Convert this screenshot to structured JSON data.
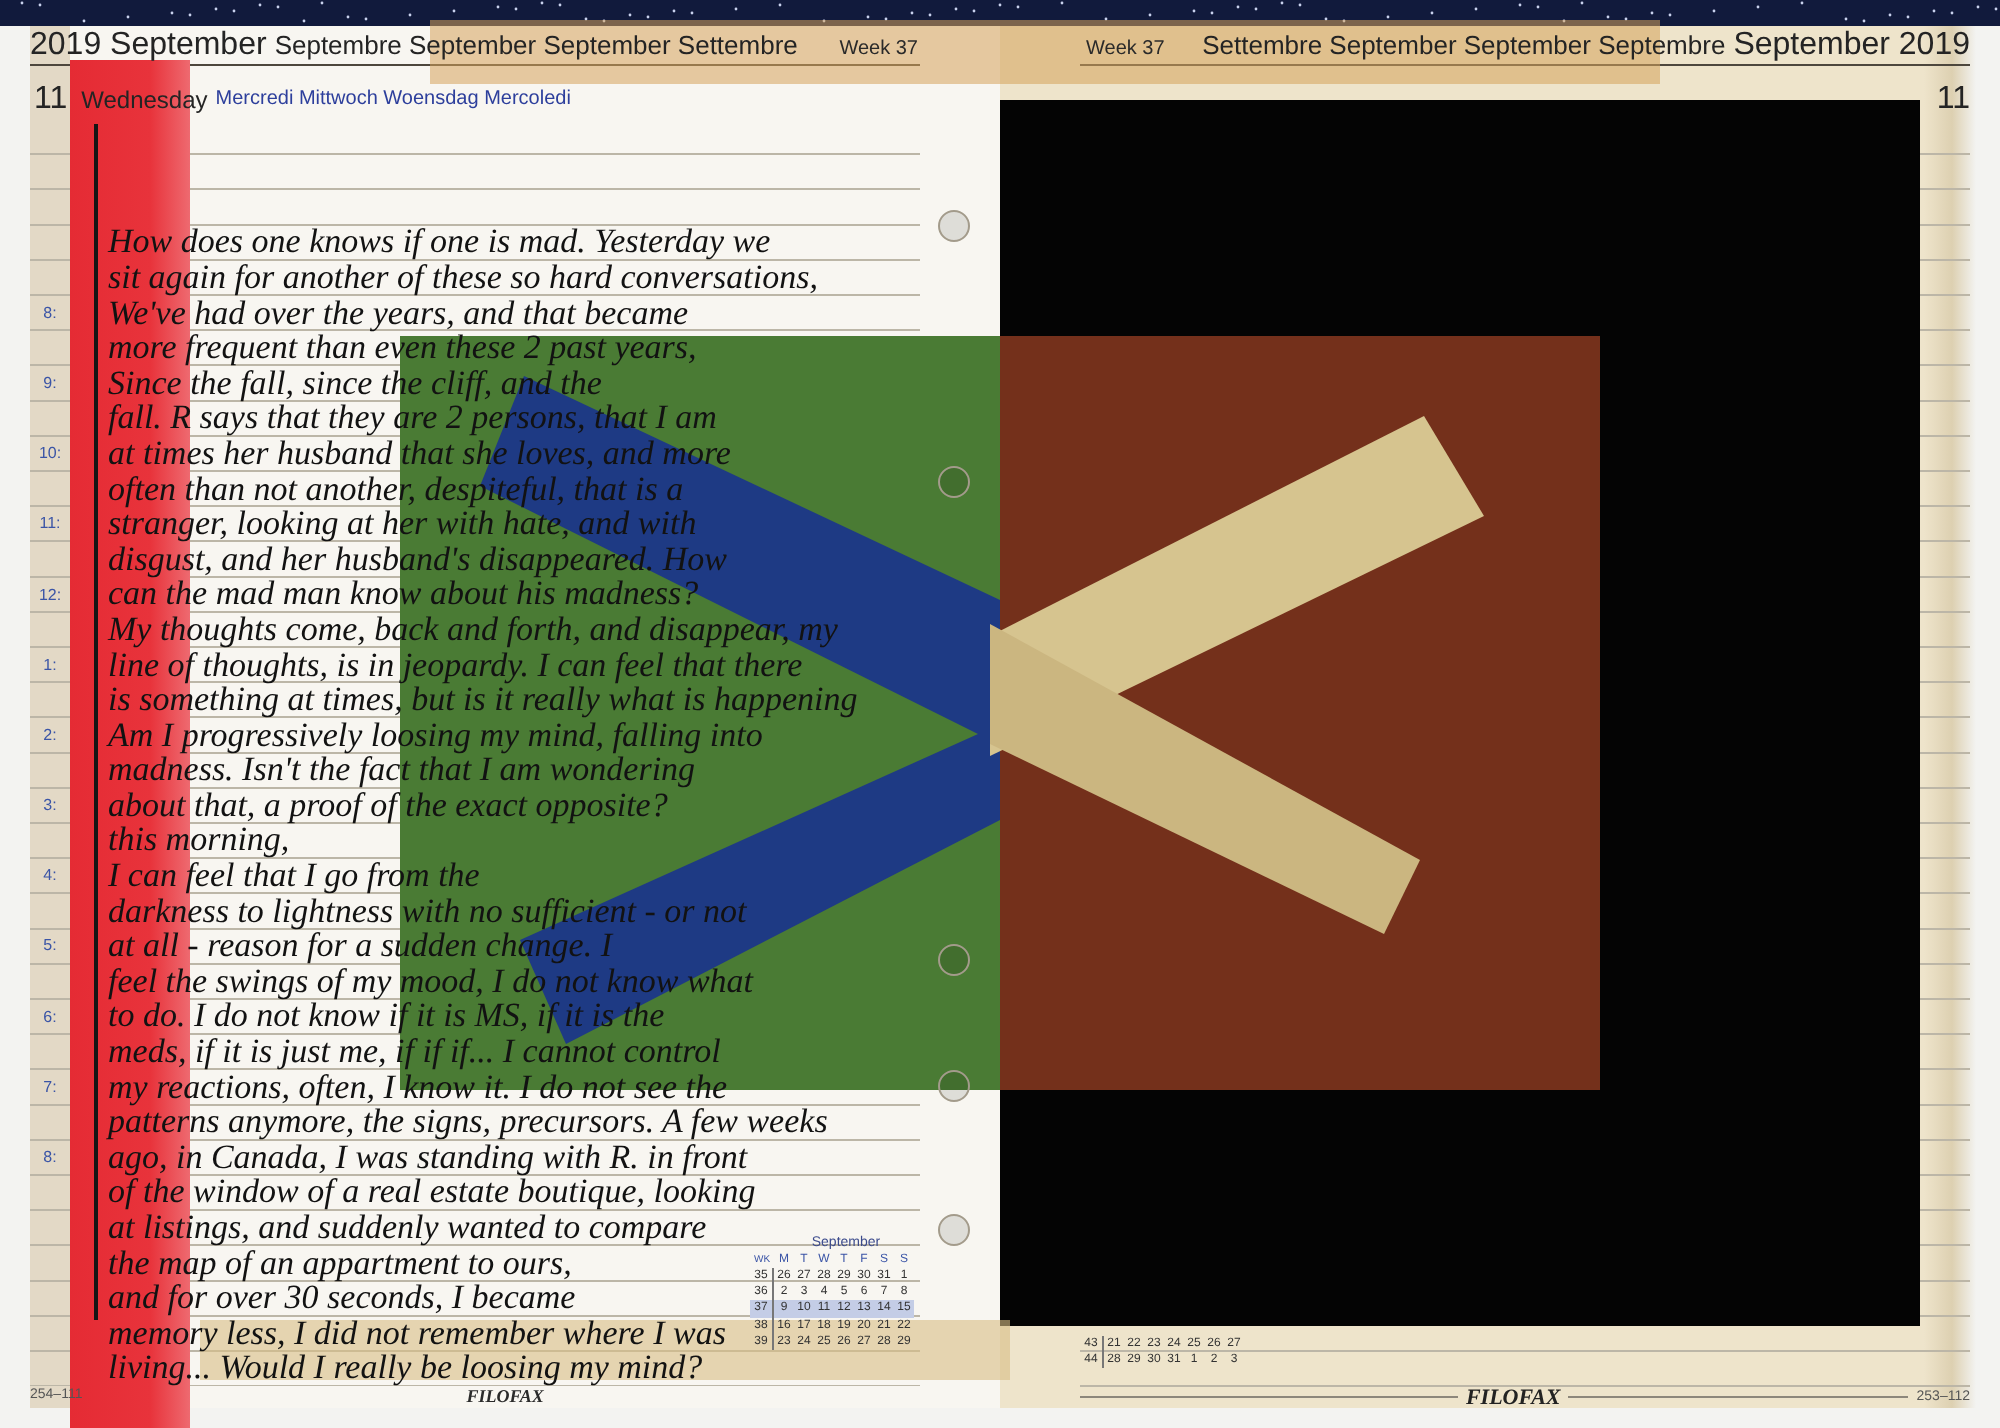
{
  "left_page": {
    "header": {
      "title": "2019 September",
      "translations": "Septembre September September Settembre",
      "week": "Week 37"
    },
    "day": {
      "number": "11",
      "weekday": "Wednesday",
      "translations": "Mercredi Mittwoch Woensdag Mercoledi"
    },
    "hours": [
      "8:",
      "9:",
      "10:",
      "11:",
      "12:",
      "1:",
      "2:",
      "3:",
      "4:",
      "5:",
      "6:",
      "7:",
      "8:"
    ],
    "handwriting": [
      "How does one knows if one is mad. Yesterday we",
      "sit again for another of these so hard conversations,",
      "We've had over the years, and that became",
      "more frequent than even these 2 past years,",
      "Since the fall, since the cliff, and the",
      "fall. R says that they are 2 persons, that I am",
      "at times her husband that she loves, and more",
      "often than not another, despiteful, that is a",
      "stranger, looking at her with hate, and with",
      "disgust, and her husband's disappeared. How",
      "can the mad man know about his madness?",
      "My thoughts come, back and forth, and disappear, my",
      "line of thoughts, is in jeopardy. I can feel that there",
      "is something at times, but is it really what is happening",
      "Am I progressively loosing my mind, falling into",
      "madness. Isn't the fact that I am wondering",
      "about that, a proof of the exact opposite?",
      "this morning,",
      "I can feel that I go from the",
      "darkness to lightness with no sufficient - or not",
      "at all - reason for a sudden change. I",
      "feel the swings of my mood, I do not know what",
      "to do. I do not know if it is MS, if it is the",
      "meds, if it is just me, if if if... I cannot control",
      "my reactions, often, I know it. I do not see the",
      "patterns anymore, the signs, precursors. A few weeks",
      "ago, in Canada, I was standing with R. in front",
      "of the window of a real estate boutique, looking",
      "at listings, and suddenly wanted to compare",
      "the map of an appartment to ours,",
      "and for over 30 seconds, I became",
      "memory less, I did not remember where I was",
      "living... Would I really be loosing my mind?"
    ],
    "mini_calendar": {
      "title": "September",
      "columns": [
        "WK",
        "M",
        "T",
        "W",
        "T",
        "F",
        "S",
        "S"
      ],
      "weeks": [
        {
          "week": "35",
          "days": [
            "26",
            "27",
            "28",
            "29",
            "30",
            "31",
            "1"
          ],
          "selected": false
        },
        {
          "week": "36",
          "days": [
            "2",
            "3",
            "4",
            "5",
            "6",
            "7",
            "8"
          ],
          "selected": false
        },
        {
          "week": "37",
          "days": [
            "9",
            "10",
            "11",
            "12",
            "13",
            "14",
            "15"
          ],
          "selected": true
        },
        {
          "week": "38",
          "days": [
            "16",
            "17",
            "18",
            "19",
            "20",
            "21",
            "22"
          ],
          "selected": false
        },
        {
          "week": "39",
          "days": [
            "23",
            "24",
            "25",
            "26",
            "27",
            "28",
            "29"
          ],
          "selected": false
        }
      ]
    },
    "page_number": "254–111",
    "brand": "FILOFAX"
  },
  "right_page": {
    "header": {
      "week": "Week 37",
      "translations": "Settembre September September Septembre",
      "title": "September 2019"
    },
    "day": {
      "number": "11"
    },
    "mini_calendar": {
      "weeks": [
        {
          "week": "43",
          "days": [
            "21",
            "22",
            "23",
            "24",
            "25",
            "26",
            "27"
          ]
        },
        {
          "week": "44",
          "days": [
            "28",
            "29",
            "30",
            "31",
            "1",
            "2",
            "3"
          ]
        }
      ]
    },
    "page_number": "253–112",
    "brand": "FILOFAX"
  }
}
